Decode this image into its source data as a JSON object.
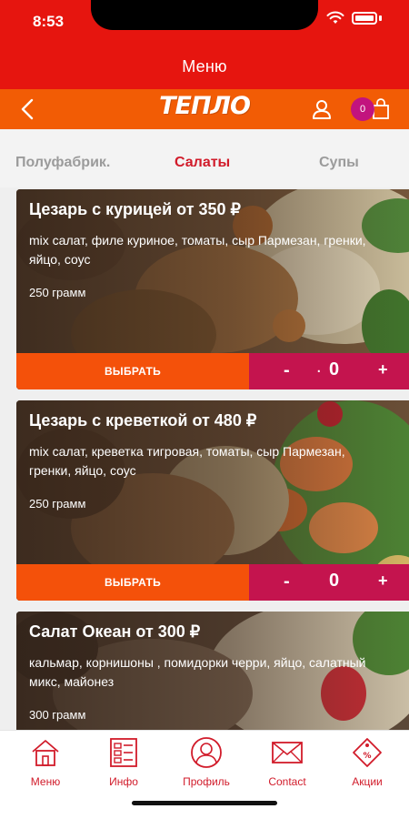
{
  "status": {
    "time": "8:53"
  },
  "header": {
    "title": "Меню"
  },
  "appbar": {
    "logo": "ТЕПЛО",
    "cart_count": "0"
  },
  "tabs": [
    {
      "label": "Полуфабрик.",
      "active": false
    },
    {
      "label": "Салаты",
      "active": true
    },
    {
      "label": "Супы",
      "active": false
    }
  ],
  "cards": [
    {
      "title": "Цезарь с курицей от 350 ₽",
      "description": "mix салат, филе куриное, томаты, сыр Пармезан, гренки, яйцо, соус",
      "weight": "250 грамм",
      "button": "ВЫБРАТЬ",
      "minus": "-",
      "dot": ".",
      "quantity": "0",
      "plus": "+"
    },
    {
      "title": "Цезарь с креветкой от 480 ₽",
      "description": "mix салат, креветка тигровая, томаты, сыр Пармезан, гренки, яйцо, соус",
      "weight": "250 грамм",
      "button": "ВЫБРАТЬ",
      "minus": "-",
      "quantity": "0",
      "plus": "+"
    },
    {
      "title": "Салат Океан от 300 ₽",
      "description": "кальмар, корнишоны , помидорки черри, яйцо, салатный микс, майонез",
      "weight": "300 грамм"
    }
  ],
  "bottom_nav": [
    {
      "label": "Меню",
      "icon": "home-icon"
    },
    {
      "label": "Инфо",
      "icon": "info-list-icon"
    },
    {
      "label": "Профиль",
      "icon": "profile-icon"
    },
    {
      "label": "Contact",
      "icon": "envelope-icon"
    },
    {
      "label": "Акции",
      "icon": "promo-tag-icon"
    }
  ],
  "colors": {
    "header_red": "#e6150f",
    "appbar_orange": "#f25c05",
    "accent_red": "#d11b2a",
    "choose_orange": "#f4510a",
    "stepper_crimson": "#c4144e",
    "badge_magenta": "#c2137e"
  }
}
